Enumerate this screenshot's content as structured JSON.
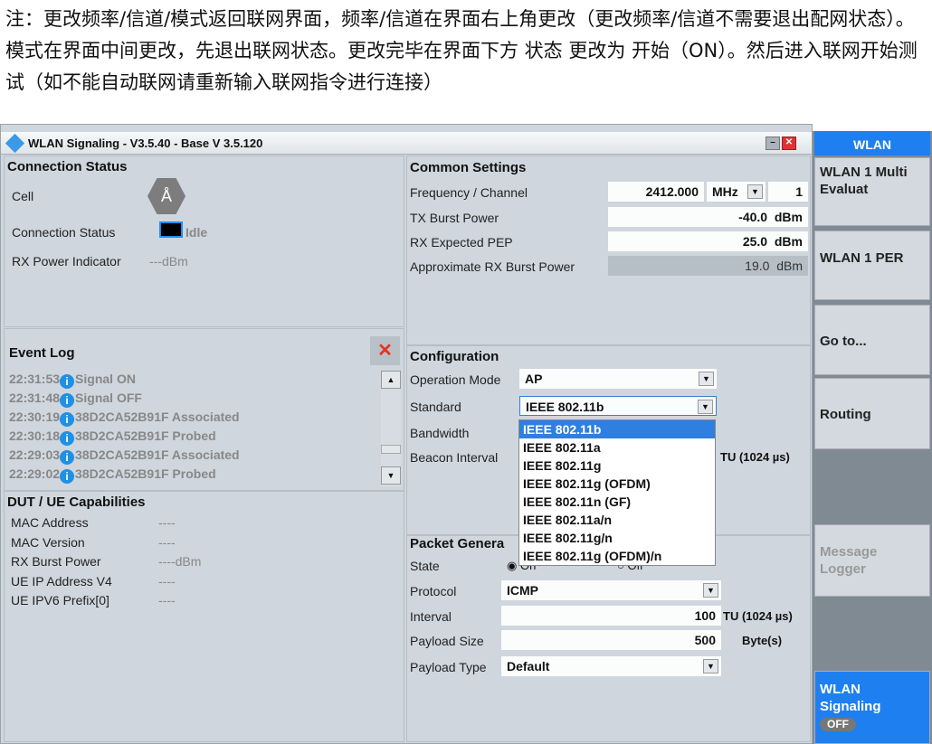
{
  "note": "注：更改频率/信道/模式返回联网界面，频率/信道在界面右上角更改（更改频率/信道不需要退出配网状态）。模式在界面中间更改，先退出联网状态。更改完毕在界面下方 状态 更改为 开始（ON）。然后进入联网开始测试（如不能自动联网请重新输入联网指令进行连接）",
  "window": {
    "title": "WLAN Signaling  - V3.5.40 - Base V 3.5.120"
  },
  "connection": {
    "title": "Connection Status",
    "cell_label": "Cell",
    "status_label": "Connection Status",
    "status_value": "Idle",
    "rx_label": "RX Power Indicator",
    "rx_value": "---dBm"
  },
  "event_log": {
    "title": "Event Log",
    "clear": "✕",
    "entries": [
      {
        "time": "22:31:53",
        "text": "Signal ON"
      },
      {
        "time": "22:31:48",
        "text": "Signal OFF"
      },
      {
        "time": "22:30:19",
        "text": "38D2CA52B91F Associated"
      },
      {
        "time": "22:30:18",
        "text": "38D2CA52B91F Probed"
      },
      {
        "time": "22:29:03",
        "text": "38D2CA52B91F Associated"
      },
      {
        "time": "22:29:02",
        "text": "38D2CA52B91F Probed"
      }
    ]
  },
  "dut": {
    "title": "DUT / UE Capabilities",
    "rows": [
      {
        "label": "MAC Address",
        "value": "----"
      },
      {
        "label": "MAC Version",
        "value": "----"
      },
      {
        "label": "RX Burst Power",
        "value": "----dBm"
      },
      {
        "label": "UE IP Address V4",
        "value": "----"
      },
      {
        "label": "UE IPV6 Prefix[0]",
        "value": "----"
      }
    ]
  },
  "common": {
    "title": "Common Settings",
    "freq_label": "Frequency / Channel",
    "freq": "2412.000",
    "freq_unit": "MHz",
    "channel": "1",
    "tx_label": "TX Burst Power",
    "tx": "-40.0",
    "rx_label": "RX Expected PEP",
    "rx": "25.0",
    "approx_label": "Approximate RX Burst Power",
    "approx": "19.0",
    "dbm": "dBm"
  },
  "config": {
    "title": "Configuration",
    "opmode_label": "Operation Mode",
    "opmode": "AP",
    "standard_label": "Standard",
    "standard": "IEEE 802.11b",
    "bandwidth_label": "Bandwidth",
    "beacon_label": "Beacon Interval",
    "beacon_unit": "TU  (1024 µs)",
    "options": [
      "IEEE 802.11b",
      "IEEE 802.11a",
      "IEEE 802.11g",
      "IEEE 802.11g (OFDM)",
      "IEEE 802.11n (GF)",
      "IEEE 802.11a/n",
      "IEEE 802.11g/n",
      "IEEE 802.11g (OFDM)/n"
    ]
  },
  "packet": {
    "title": "Packet Genera",
    "state_label": "State",
    "on": "On",
    "off": "Off",
    "protocol_label": "Protocol",
    "protocol": "ICMP",
    "interval_label": "Interval",
    "interval": "100",
    "interval_unit": "TU  (1024 µs)",
    "size_label": "Payload Size",
    "size": "500",
    "size_unit": "Byte(s)",
    "type_label": "Payload Type",
    "type": "Default"
  },
  "sidebar": {
    "header": "WLAN",
    "b1": "WLAN 1 Multi Evaluat",
    "b2": "WLAN 1 PER",
    "b3": "Go to...",
    "b4": "Routing",
    "b5": "Message Logger",
    "b6": "WLAN Signaling",
    "b6_state": "OFF"
  },
  "colors": {
    "accent": "#1e7ff0",
    "panel": "#cfd6dd",
    "clear_x": "#e8321e"
  }
}
